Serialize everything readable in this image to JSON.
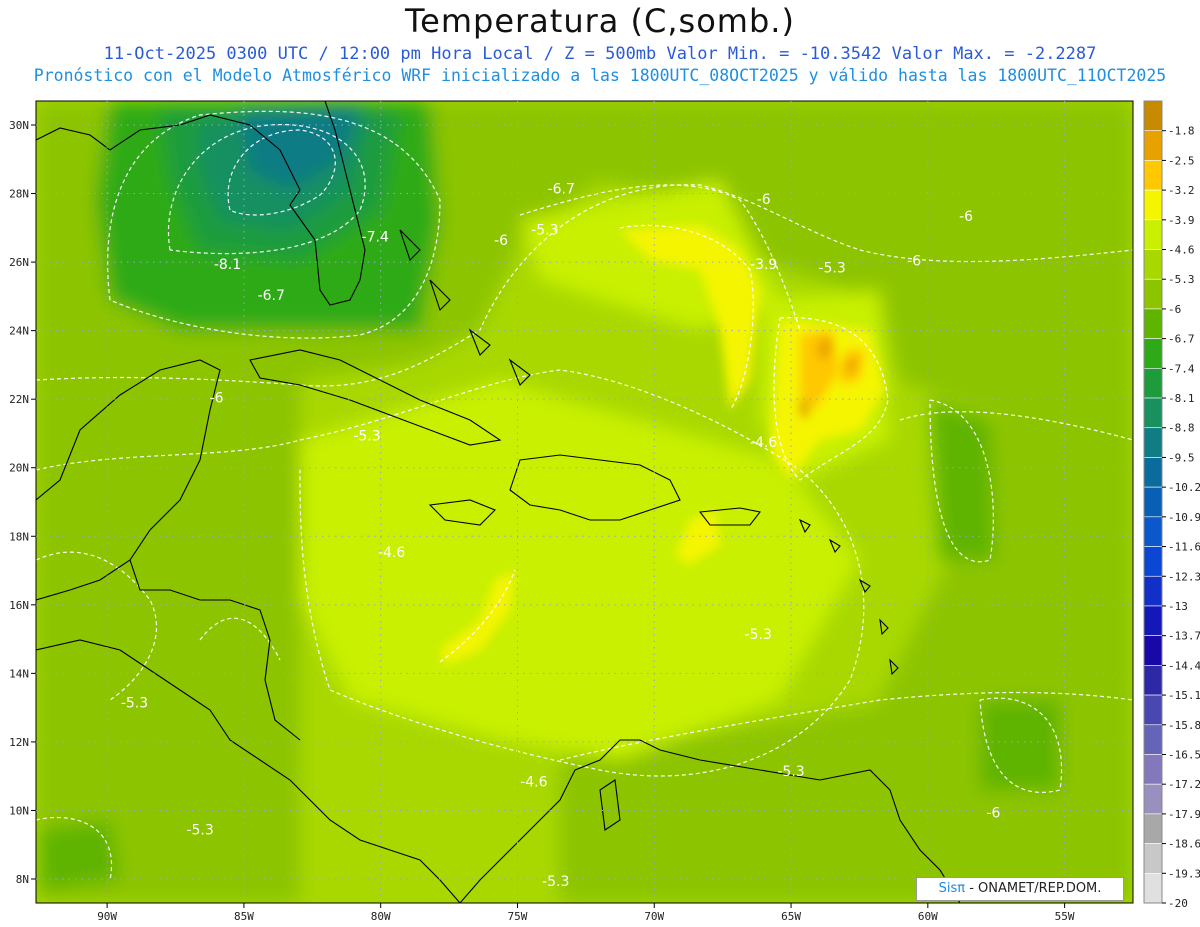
{
  "header": {
    "title": "Temperatura (C,somb.)",
    "subtitle_line1": "11-Oct-2025  0300 UTC / 12:00 pm Hora Local / Z = 500mb  Valor Min. = -10.3542  Valor Max. = -2.2287",
    "subtitle_line2": "Pronóstico con el Modelo Atmosférico WRF inicializado a las 1800UTC_08OCT2025 y válido hasta las  1800UTC_11OCT2025"
  },
  "axes": {
    "lat_labels": [
      "30N",
      "28N",
      "26N",
      "24N",
      "22N",
      "20N",
      "18N",
      "16N",
      "14N",
      "12N",
      "10N",
      "8N"
    ],
    "lon_labels": [
      "90W",
      "85W",
      "80W",
      "75W",
      "70W",
      "65W",
      "60W",
      "55W"
    ],
    "lat_values": [
      30,
      28,
      26,
      24,
      22,
      20,
      18,
      16,
      14,
      12,
      10,
      8
    ],
    "lon_values": [
      -90,
      -85,
      -80,
      -75,
      -70,
      -65,
      -60,
      -55
    ],
    "lat_range": [
      7.3,
      30.7
    ],
    "lon_range": [
      -92.6,
      -52.5
    ]
  },
  "colorbar": {
    "labels": [
      "-1.8",
      "-2.5",
      "-3.2",
      "-3.9",
      "-4.6",
      "-5.3",
      "-6",
      "-6.7",
      "-7.4",
      "-8.1",
      "-8.8",
      "-9.5",
      "-10.2",
      "-10.9",
      "-11.6",
      "-12.3",
      "-13",
      "-13.7",
      "-14.4",
      "-15.1",
      "-15.8",
      "-16.5",
      "-17.2",
      "-17.9",
      "-18.6",
      "-19.3",
      "-20"
    ],
    "colors": [
      "#c88a00",
      "#e8a200",
      "#ffc800",
      "#f5f500",
      "#c8f000",
      "#a8d800",
      "#8cc400",
      "#5fb400",
      "#2eaa18",
      "#1e9c3c",
      "#189060",
      "#107c84",
      "#0a6c9c",
      "#0860b4",
      "#0a58cc",
      "#0a48d4",
      "#1230c8",
      "#1418b8",
      "#1808a8",
      "#2c28a8",
      "#4848b0",
      "#6464b8",
      "#8478bc",
      "#9a90c0",
      "#a8a8a8",
      "#c8c8c8",
      "#e0e0e0"
    ]
  },
  "contour_labels": [
    {
      "text": "-6.7",
      "lon": -73.4,
      "lat": 28.0
    },
    {
      "text": "-6",
      "lon": -66.0,
      "lat": 27.7
    },
    {
      "text": "-6",
      "lon": -58.6,
      "lat": 27.2
    },
    {
      "text": "-5.3",
      "lon": -74.0,
      "lat": 26.8
    },
    {
      "text": "-6",
      "lon": -75.6,
      "lat": 26.5
    },
    {
      "text": "-7.4",
      "lon": -80.2,
      "lat": 26.6
    },
    {
      "text": "-8.1",
      "lon": -85.6,
      "lat": 25.8
    },
    {
      "text": "-6.7",
      "lon": -84.0,
      "lat": 24.9
    },
    {
      "text": "-3.9",
      "lon": -66.0,
      "lat": 25.8
    },
    {
      "text": "-5.3",
      "lon": -63.5,
      "lat": 25.7
    },
    {
      "text": "-6",
      "lon": -60.5,
      "lat": 25.9
    },
    {
      "text": "-6",
      "lon": -86.0,
      "lat": 21.9
    },
    {
      "text": "-5.3",
      "lon": -80.5,
      "lat": 20.8
    },
    {
      "text": "-4.6",
      "lon": -66.0,
      "lat": 20.6
    },
    {
      "text": "-4.6",
      "lon": -79.6,
      "lat": 17.4
    },
    {
      "text": "-5.3",
      "lon": -66.2,
      "lat": 15.0
    },
    {
      "text": "-5.3",
      "lon": -89.0,
      "lat": 13.0
    },
    {
      "text": "-5.3",
      "lon": -65.0,
      "lat": 11.0
    },
    {
      "text": "-4.6",
      "lon": -74.4,
      "lat": 10.7
    },
    {
      "text": "-5.3",
      "lon": -86.6,
      "lat": 9.3
    },
    {
      "text": "-6",
      "lon": -57.6,
      "lat": 9.8
    },
    {
      "text": "-5.3",
      "lon": -73.6,
      "lat": 7.8
    }
  ],
  "credit": {
    "sis": "Sisπ",
    "rest": " - ONAMET/REP.DOM."
  }
}
